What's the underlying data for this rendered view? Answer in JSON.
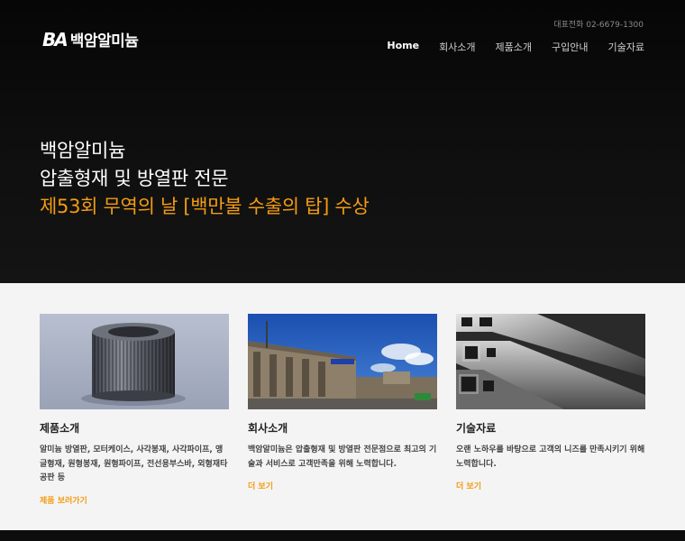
{
  "header": {
    "logo_mark": "BA",
    "logo_text": "백암알미늄",
    "phone": "대표전화 02-6679-1300",
    "nav": [
      {
        "label": "Home"
      },
      {
        "label": "회사소개"
      },
      {
        "label": "제품소개"
      },
      {
        "label": "구입안내"
      },
      {
        "label": "기술자료"
      }
    ]
  },
  "hero": {
    "line1": "백암알미늄",
    "line2": "압출형재 및 방열판 전문",
    "line3": "제53회 무역의 날 [백만불 수출의 탑] 수상",
    "accent_color": "#f39c12"
  },
  "cards": [
    {
      "title": "제품소개",
      "desc": "알미늄 방열판, 모터케이스, 사각봉재, 사각파이프, 앵글형재, 원형봉재, 원형파이프, 전선용부스바, 외형재타공판 등",
      "link": "제품 보러가기",
      "image_icon": "heatsink-image"
    },
    {
      "title": "회사소개",
      "desc": "백암알미늄은 압출형재 및 방열판 전문점으로 최고의 기술과 서비스로 고객만족을 위해 노력합니다.",
      "link": "더 보기",
      "image_icon": "building-image"
    },
    {
      "title": "기술자료",
      "desc": "오랜 노하우를 바탕으로 고객의 니즈를 만족시키기 위해 노력합니다.",
      "link": "더 보기",
      "image_icon": "profiles-image"
    }
  ]
}
